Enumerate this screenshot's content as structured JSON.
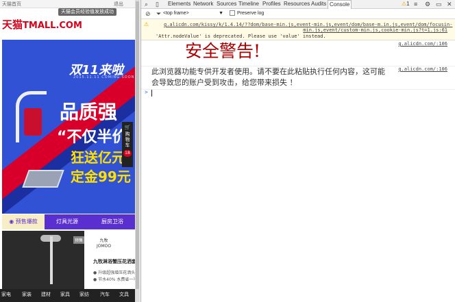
{
  "page": {
    "topbar": {
      "tab1": "天猫首页",
      "popup_msg": "天猫会员经验值发放成功",
      "exit": "退出"
    },
    "logo": {
      "cn": "天猫",
      "en": "TMALL.COM"
    },
    "banner": {
      "double11": "双11来啦",
      "subline": "2015.11.11  COMING SOON",
      "title": "品质强",
      "line1": "“不仅半价",
      "line2": "狂送亿元",
      "line3": "定金99元"
    },
    "cart": {
      "label": "购物车",
      "count": "18"
    },
    "tabs": [
      "预售爆款",
      "灯具光源",
      "厨房卫浴"
    ],
    "product": {
      "badge": "预售",
      "brand_cn": "九牧",
      "brand_en": "JOMOO",
      "name": "九牧淋浴蟹压花洒套",
      "feature1": "● 升级超强增压花洒头",
      "feature2": "● 节水40% 水费省一半"
    },
    "categories": [
      "家电",
      "家装",
      "建材",
      "家具",
      "家纺",
      "汽车",
      "文具"
    ]
  },
  "devtools": {
    "tabs": [
      "Elements",
      "Network",
      "Sources",
      "Timeline",
      "Profiles",
      "Resources",
      "Audits",
      "Console"
    ],
    "active_tab": "Console",
    "warning_count": "1",
    "frame_select": "<top frame>",
    "preserve_log": "Preserve log",
    "warning": {
      "source_url": "g.alicdn.com/kissy/k/1.4.14/??dom/base-min.js,event-min.js,event/dom/base-m.in.js,event/dom/focusin-",
      "source_url2": "min.js,event/custom-min.js,cookie-min.js?t=1.js:61",
      "message": "'Attr.nodeValue' is deprecated. Please use 'value' instead."
    },
    "log1": {
      "text": "安全警告!",
      "source": "g.alicdn.com/:106"
    },
    "log2": {
      "text": "此浏览器功能专供开发者使用。请不要在此粘贴执行任何内容，这可能会导致您的账户受到攻击，给您带来损失 ！",
      "source": "g.alicdn.com/:106"
    },
    "prompt": ">"
  }
}
